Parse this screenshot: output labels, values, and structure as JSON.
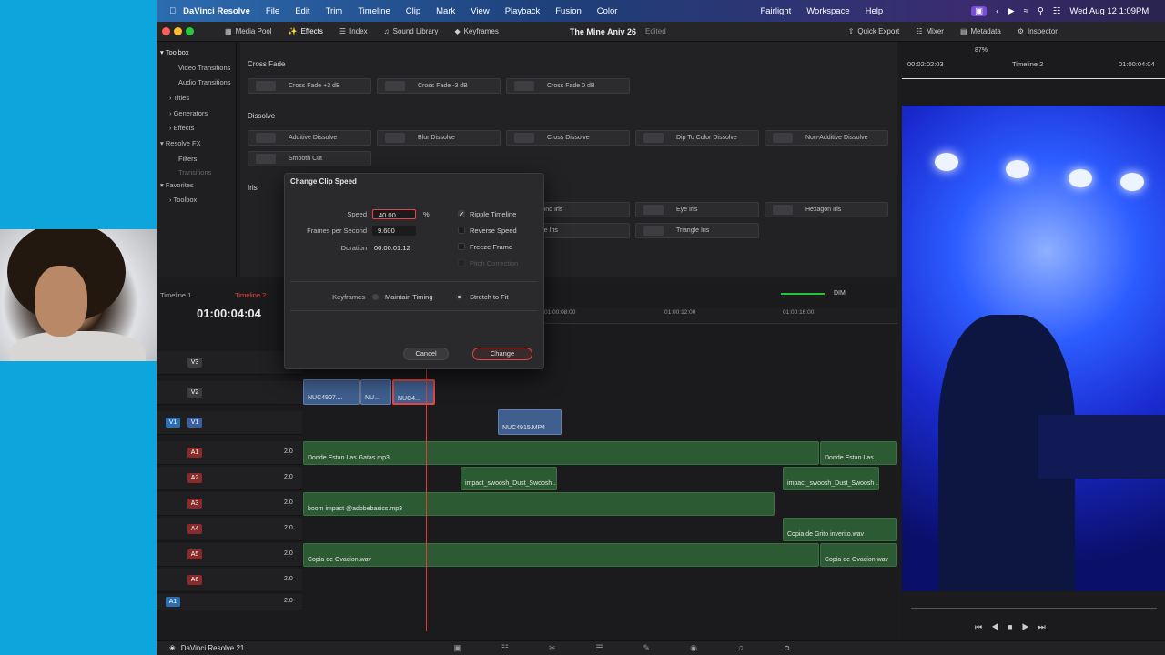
{
  "menubar": {
    "app": "DaVinci Resolve",
    "items": [
      "File",
      "Edit",
      "Trim",
      "Timeline",
      "Clip",
      "Mark",
      "View",
      "Playback",
      "Fusion",
      "Color"
    ],
    "right_items": [
      "Fairlight",
      "Workspace",
      "Help"
    ],
    "datetime": "Wed Aug 12  1:09PM"
  },
  "titlebar": {
    "left_items": [
      "Media Pool",
      "Effects",
      "Index",
      "Sound Library",
      "Keyframes"
    ],
    "project": "The Mine Aniv 26",
    "status": "Edited",
    "right_items": [
      "Quick Export",
      "Mixer",
      "Metadata",
      "Inspector"
    ]
  },
  "toolbox": {
    "items": [
      "Toolbox",
      "Video Transitions",
      "Audio Transitions",
      "Titles",
      "Generators",
      "Effects",
      "Resolve FX",
      "Filters",
      "Transitions",
      "Favorites",
      "Toolbox"
    ]
  },
  "effects": {
    "sections": [
      "Cross Fade",
      "Dissolve",
      "Iris"
    ],
    "cross_fade": [
      "Cross Fade +3 dB",
      "Cross Fade -3 dB",
      "Cross Fade 0 dB"
    ],
    "dissolve": [
      "Additive Dissolve",
      "Blur Dissolve",
      "Cross Dissolve",
      "Dip To Color Dissolve",
      "Non-Additive Dissolve",
      "Smooth Cut"
    ],
    "iris": [
      "Diamond Iris",
      "Eye Iris",
      "Hexagon Iris",
      "Square Iris",
      "Triangle Iris"
    ]
  },
  "dialog": {
    "title": "Change Clip Speed",
    "speed_label": "Speed",
    "speed_value": "40.00",
    "speed_unit": "%",
    "fps_label": "Frames per Second",
    "fps_value": "9.600",
    "duration_label": "Duration",
    "duration_value": "00:00:01:12",
    "options": [
      "Ripple Timeline",
      "Reverse Speed",
      "Freeze Frame",
      "Pitch Correction"
    ],
    "keyframes_label": "Keyframes",
    "maintain": "Maintain Timing",
    "stretch": "Stretch to Fit",
    "cancel": "Cancel",
    "change": "Change"
  },
  "timeline": {
    "tabs": [
      "Timeline 1",
      "Timeline 2"
    ],
    "timecode": "01:00:04:04",
    "ruler": [
      "01:00:08:00",
      "01:00:12:00",
      "01:00:16:00"
    ],
    "dim": "DIM",
    "tracks": [
      "V3",
      "V2",
      "V1",
      "A1",
      "A2",
      "A3",
      "A4",
      "A5",
      "A6"
    ],
    "audio_gain": "2.0",
    "src_tags": [
      "V1",
      "A1"
    ],
    "video_clips": [
      "NUC4907....",
      "NU...",
      "NUC4...",
      "NUC4915.MP4"
    ],
    "audio_clips": [
      "Donde Estan Las Gatas.mp3",
      "Donde Estan Las ...",
      "impact_swoosh_Dust_Swoosh ...",
      "impact_swoosh_Dust_Swoosh ...",
      "boom impact @adobebasics.mp3",
      "Copia de Grito inverito.wav",
      "Copia de Ovacion.wav",
      "Copia de Ovacion.wav"
    ]
  },
  "viewer": {
    "timecode_left": "00:02:02:03",
    "timeline_name": "Timeline 2",
    "timecode_right": "01:00:04:04",
    "zoom": "87%"
  },
  "bottombar": {
    "app": "DaVinci Resolve 21"
  },
  "colors": {
    "accent": "#e64545",
    "clip_video": "#3f5f8f",
    "clip_audio": "#2c5a33",
    "playhead": "#e03c3c"
  }
}
